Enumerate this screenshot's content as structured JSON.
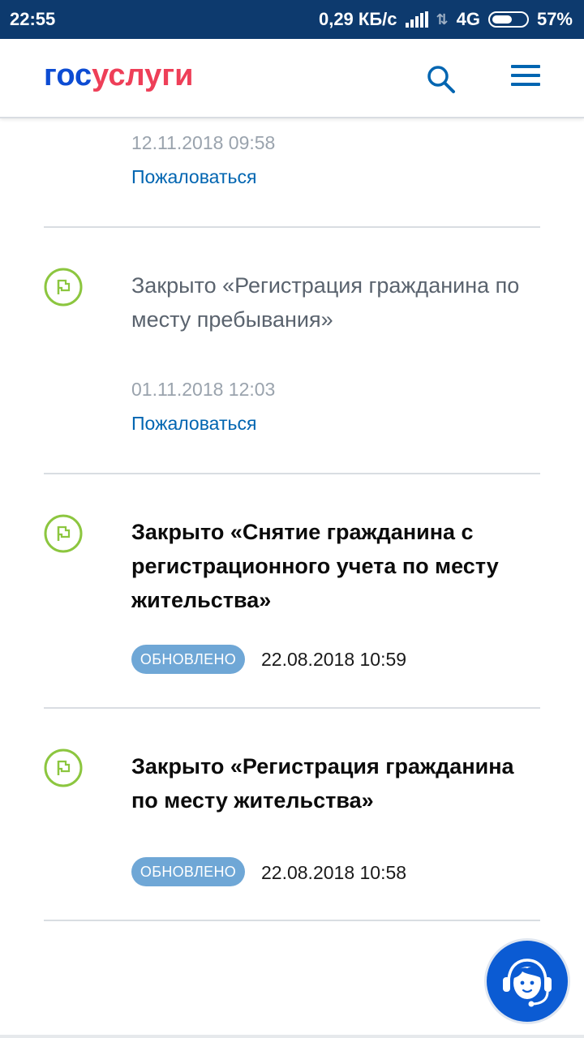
{
  "status_bar": {
    "time": "22:55",
    "speed": "0,29 КБ/с",
    "network": "4G",
    "battery": "57%"
  },
  "header": {
    "logo_part1": "гос",
    "logo_part2": "услуги",
    "search_icon": "search-icon",
    "menu_icon": "hamburger-menu-icon"
  },
  "feed": {
    "items": [
      {
        "date": "12.11.2018 09:58",
        "action": "Пожаловаться"
      },
      {
        "icon": "flag-icon",
        "title": "Закрыто «Регистрация гражданина по месту пребывания»",
        "date": "01.11.2018 12:03",
        "action": "Пожаловаться"
      },
      {
        "icon": "flag-icon",
        "title": "Закрыто «Снятие гражданина с регистрационного учета по месту жительства»",
        "badge": "ОБНОВЛЕНО",
        "date": "22.08.2018 10:59"
      },
      {
        "icon": "flag-icon",
        "title": "Закрыто «Регистрация гражданина по месту жительства»",
        "badge": "ОБНОВЛЕНО",
        "date": "22.08.2018 10:58"
      }
    ]
  },
  "support": {
    "icon": "support-operator-icon"
  },
  "colors": {
    "status_bar": "#0d3a6e",
    "logo_blue": "#0d4cd3",
    "logo_red": "#ee3f58",
    "link": "#0065b1",
    "flag_green": "#8cc63f",
    "badge": "#6fa7d6",
    "support_button": "#0b5bd3"
  }
}
